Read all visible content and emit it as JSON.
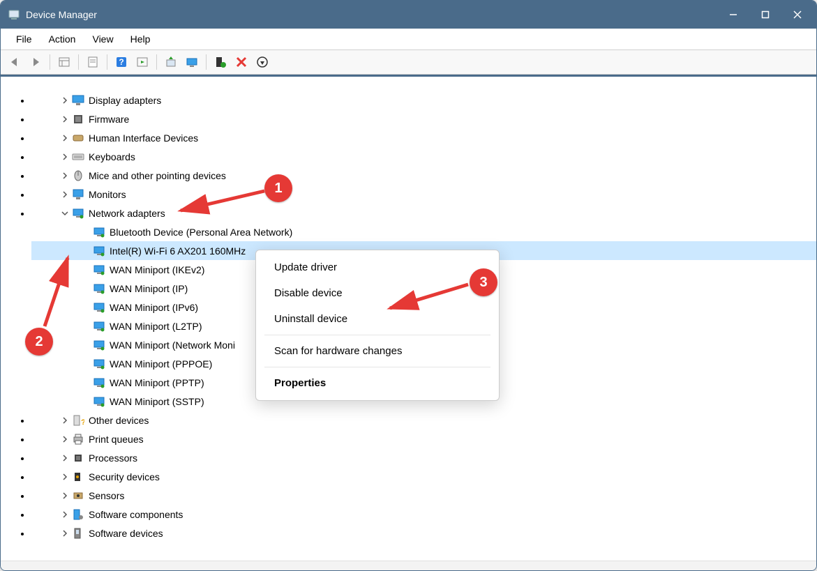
{
  "title": "Device Manager",
  "menu": {
    "file": "File",
    "action": "Action",
    "view": "View",
    "help": "Help"
  },
  "tree": {
    "categories": [
      {
        "name": "Display adapters",
        "icon": "display-icon",
        "expanded": false
      },
      {
        "name": "Firmware",
        "icon": "chip-icon",
        "expanded": false
      },
      {
        "name": "Human Interface Devices",
        "icon": "hid-icon",
        "expanded": false
      },
      {
        "name": "Keyboards",
        "icon": "keyboard-icon",
        "expanded": false
      },
      {
        "name": "Mice and other pointing devices",
        "icon": "mouse-icon",
        "expanded": false
      },
      {
        "name": "Monitors",
        "icon": "monitor-icon",
        "expanded": false
      },
      {
        "name": "Network adapters",
        "icon": "network-icon",
        "expanded": true,
        "children": [
          {
            "name": "Bluetooth Device (Personal Area Network)",
            "selected": false
          },
          {
            "name": "Intel(R) Wi-Fi 6 AX201 160MHz",
            "selected": true
          },
          {
            "name": "WAN Miniport (IKEv2)",
            "selected": false
          },
          {
            "name": "WAN Miniport (IP)",
            "selected": false
          },
          {
            "name": "WAN Miniport (IPv6)",
            "selected": false
          },
          {
            "name": "WAN Miniport (L2TP)",
            "selected": false
          },
          {
            "name": "WAN Miniport (Network Moni",
            "selected": false
          },
          {
            "name": "WAN Miniport (PPPOE)",
            "selected": false
          },
          {
            "name": "WAN Miniport (PPTP)",
            "selected": false
          },
          {
            "name": "WAN Miniport (SSTP)",
            "selected": false
          }
        ]
      },
      {
        "name": "Other devices",
        "icon": "other-icon",
        "expanded": false
      },
      {
        "name": "Print queues",
        "icon": "printer-icon",
        "expanded": false
      },
      {
        "name": "Processors",
        "icon": "cpu-icon",
        "expanded": false
      },
      {
        "name": "Security devices",
        "icon": "security-icon",
        "expanded": false
      },
      {
        "name": "Sensors",
        "icon": "sensor-icon",
        "expanded": false
      },
      {
        "name": "Software components",
        "icon": "software-icon",
        "expanded": false
      },
      {
        "name": "Software devices",
        "icon": "softdev-icon",
        "expanded": false
      }
    ]
  },
  "context_menu": {
    "update": "Update driver",
    "disable": "Disable device",
    "uninstall": "Uninstall device",
    "scan": "Scan for hardware changes",
    "properties": "Properties"
  },
  "annotations": {
    "b1": "1",
    "b2": "2",
    "b3": "3"
  }
}
